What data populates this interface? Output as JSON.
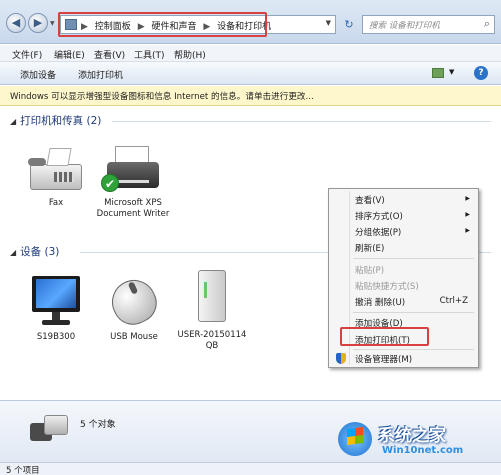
{
  "address": {
    "breadcrumbs": [
      "控制面板",
      "硬件和声音",
      "设备和打印机"
    ],
    "separator": "▶",
    "search_placeholder": "搜索 设备和打印机"
  },
  "menubar": {
    "items": [
      "文件(F)",
      "编辑(E)",
      "查看(V)",
      "工具(T)",
      "帮助(H)"
    ]
  },
  "commandbar": {
    "add_device": "添加设备",
    "add_printer": "添加打印机"
  },
  "infobar": {
    "text": "Windows 可以显示增强型设备图标和信息 Internet 的信息。请单击进行更改..."
  },
  "groups": {
    "printers": {
      "header": "打印机和传真 (2)",
      "items": [
        "Fax",
        "Microsoft XPS Document Writer"
      ]
    },
    "devices": {
      "header": "设备 (3)",
      "items": [
        "S19B300",
        "USB Mouse",
        "USER-20150114 QB"
      ]
    }
  },
  "details": {
    "count": "5 个对象"
  },
  "statusbar": {
    "text": "5 个项目"
  },
  "context_menu": {
    "items": [
      {
        "label": "查看(V)",
        "submenu": true
      },
      {
        "label": "排序方式(O)",
        "submenu": true
      },
      {
        "label": "分组依据(P)",
        "submenu": true
      },
      {
        "label": "刷新(E)"
      },
      {
        "label": "粘贴(P)",
        "disabled": true
      },
      {
        "label": "粘贴快捷方式(S)",
        "disabled": true
      },
      {
        "label": "撤消 删除(U)",
        "shortcut": "Ctrl+Z"
      },
      {
        "label": "添加设备(D)"
      },
      {
        "label": "添加打印机(T)",
        "highlighted": true
      },
      {
        "label": "设备管理器(M)",
        "icon": "shield-icon"
      }
    ]
  },
  "watermark": {
    "title": "系统之家",
    "url": "Win10net.com"
  },
  "colors": {
    "highlight_border": "#d94040",
    "group_header": "#1e3a78",
    "infobar_bg": "#fff7cc"
  }
}
